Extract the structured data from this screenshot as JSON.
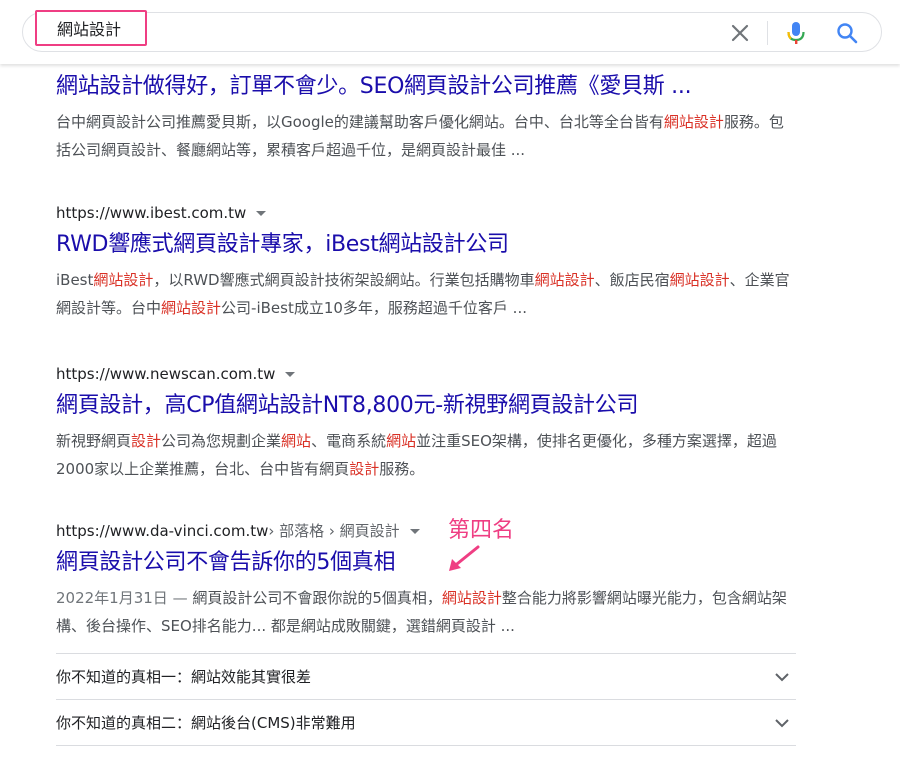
{
  "search": {
    "query": "網站設計",
    "clear_icon": "close-icon",
    "mic_icon": "microphone-icon",
    "search_icon": "search-icon"
  },
  "results": [
    {
      "title": "網站設計做得好，訂單不會少。SEO網頁設計公司推薦《愛貝斯 ...",
      "snippet": [
        {
          "t": "台中網頁設計公司推薦愛貝斯，以Google的建議幫助客戶優化網站。台中、台北等全台皆有",
          "h": false
        },
        {
          "t": "網站設計",
          "h": true
        },
        {
          "t": "服務。包括公司網頁設計、餐廳網站等，累積客戶超過千位，是網頁設計最佳 ...",
          "h": false
        }
      ]
    },
    {
      "url": "https://www.ibest.com.tw",
      "title": "RWD響應式網頁設計專家，iBest網站設計公司",
      "snippet": [
        {
          "t": "iBest",
          "h": false
        },
        {
          "t": "網站設計",
          "h": true
        },
        {
          "t": "，以RWD響應式網頁設計技術架設網站。行業包括購物車",
          "h": false
        },
        {
          "t": "網站設計",
          "h": true
        },
        {
          "t": "、飯店民宿",
          "h": false
        },
        {
          "t": "網站設計",
          "h": true
        },
        {
          "t": "、企業官網設計等。台中",
          "h": false
        },
        {
          "t": "網站設計",
          "h": true
        },
        {
          "t": "公司-iBest成立10多年，服務超過千位客戶 ...",
          "h": false
        }
      ]
    },
    {
      "url": "https://www.newscan.com.tw",
      "title": "網頁設計，高CP值網站設計NT8,800元-新視野網頁設計公司",
      "snippet": [
        {
          "t": "新視野網頁",
          "h": false
        },
        {
          "t": "設計",
          "h": true
        },
        {
          "t": "公司為您規劃企業",
          "h": false
        },
        {
          "t": "網站",
          "h": true
        },
        {
          "t": "、電商系統",
          "h": false
        },
        {
          "t": "網站",
          "h": true
        },
        {
          "t": "並注重SEO架構，使排名更優化，多種方案選擇，超過2000家以上企業推薦，台北、台中皆有網頁",
          "h": false
        },
        {
          "t": "設計",
          "h": true
        },
        {
          "t": "服務。",
          "h": false
        }
      ]
    },
    {
      "url": "https://www.da-vinci.com.tw",
      "breadcrumb": " › 部落格 › 網頁設計",
      "title": "網頁設計公司不會告訴你的5個真相",
      "date": "2022年1月31日 — ",
      "snippet": [
        {
          "t": "網頁設計公司不會跟你說的5個真相，",
          "h": false
        },
        {
          "t": "網站設計",
          "h": true
        },
        {
          "t": "整合能力將影響網站曝光能力，包含網站架構、後台操作、SEO排名能力... 都是網站成敗關鍵，選錯網頁設計 ...",
          "h": false
        }
      ]
    }
  ],
  "annotation": {
    "label": "第四名",
    "color": "#ef3e83"
  },
  "faq": [
    {
      "question": "你不知道的真相一：網站效能其實很差"
    },
    {
      "question": "你不知道的真相二：網站後台(CMS)非常難用"
    }
  ],
  "colors": {
    "link": "#1a0dab",
    "highlight": "#d93025",
    "snippet": "#4d5156"
  }
}
